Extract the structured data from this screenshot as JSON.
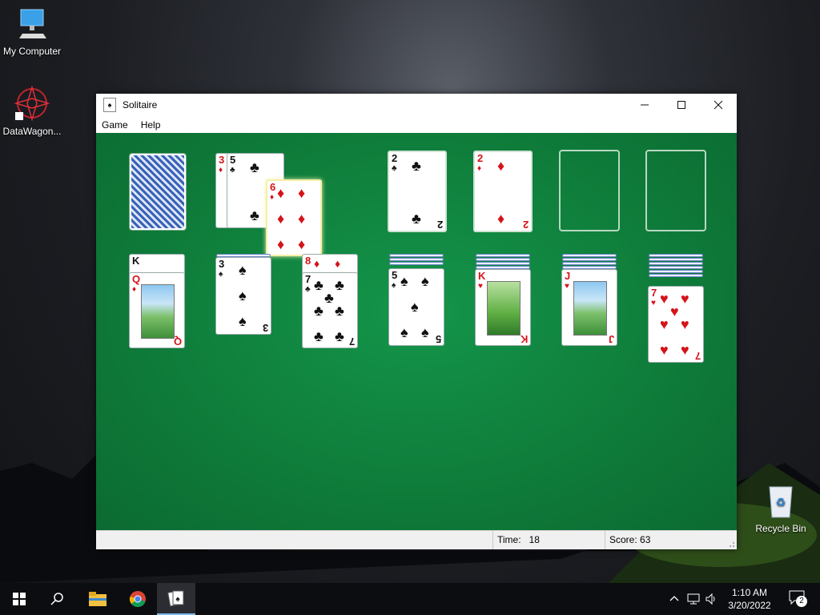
{
  "desktop": {
    "icons": [
      {
        "label": "My Computer"
      },
      {
        "label": "DataWagon..."
      },
      {
        "label": "Recycle Bin"
      }
    ]
  },
  "window": {
    "title": "Solitaire",
    "menu": [
      "Game",
      "Help"
    ],
    "status": {
      "time_label": "Time:",
      "time_value": "18",
      "score_label": "Score:",
      "score_value": "63"
    }
  },
  "game": {
    "stock": "face-down",
    "waste": [
      {
        "rank": "3",
        "suit": "♦",
        "color": "red"
      },
      {
        "rank": "5",
        "suit": "♣",
        "color": "black"
      },
      {
        "rank": "6",
        "suit": "♦",
        "color": "red",
        "highlighted": true
      }
    ],
    "foundations": [
      {
        "rank": "2",
        "suit": "♣",
        "color": "black"
      },
      {
        "rank": "2",
        "suit": "♦",
        "color": "red"
      },
      null,
      null
    ],
    "tableau": [
      {
        "hidden": 0,
        "cards": [
          {
            "rank": "K",
            "suit": "♠",
            "color": "black"
          },
          {
            "rank": "Q",
            "suit": "♦",
            "color": "red"
          }
        ]
      },
      {
        "hidden": 1,
        "cards": [
          {
            "rank": "3",
            "suit": "♠",
            "color": "black"
          }
        ]
      },
      {
        "hidden": 0,
        "cards": [
          {
            "rank": "8",
            "suit": "♦",
            "color": "red"
          },
          {
            "rank": "7",
            "suit": "♣",
            "color": "black"
          }
        ]
      },
      {
        "hidden": 3,
        "cards": [
          {
            "rank": "5",
            "suit": "♠",
            "color": "black"
          }
        ]
      },
      {
        "hidden": 4,
        "cards": [
          {
            "rank": "K",
            "suit": "♥",
            "color": "red"
          }
        ]
      },
      {
        "hidden": 5,
        "cards": [
          {
            "rank": "J",
            "suit": "♥",
            "color": "red"
          }
        ]
      },
      {
        "hidden": 6,
        "cards": [
          {
            "rank": "7",
            "suit": "♥",
            "color": "red"
          }
        ]
      }
    ]
  },
  "taskbar": {
    "clock_time": "1:10 AM",
    "clock_date": "3/20/2022",
    "notifications": "2"
  }
}
